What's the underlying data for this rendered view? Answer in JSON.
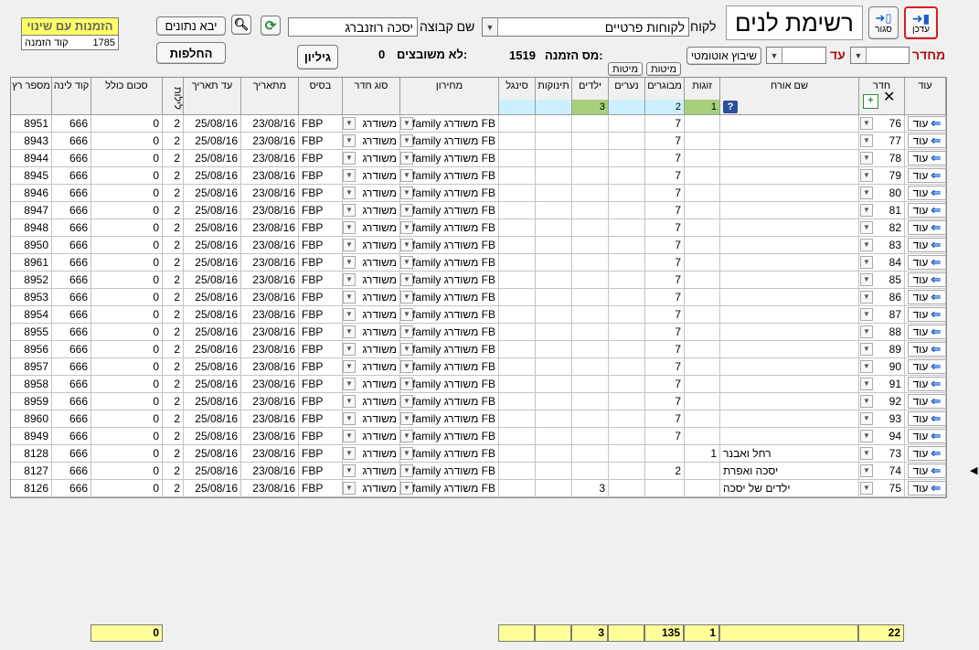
{
  "window": {
    "title": "רשימת לנים"
  },
  "toolbar": {
    "update_label": "עדכן",
    "close_label": "סגור",
    "bring_data_label": "יבא נתונים",
    "swaps_label": "החלפות",
    "sheet_label": "גיליון",
    "auto_assign_label": "שיבוץ אוטומטי",
    "sort_label_1": "מיטות",
    "sort_label_2": "מיטות"
  },
  "header": {
    "customer_label": "לקוח",
    "customer_value": "לקוחות פרטיים",
    "group_label": "שם קבוצה",
    "group_value": "יסכה רוזנברג",
    "changed_orders_label": "הזמנות עם שינוי",
    "order_code_label": "קוד הזמנה",
    "order_code_value": "1785",
    "order_number_label": "מס הזמנה:",
    "order_number_value": "1519",
    "unassigned_label": "לא משובצים:",
    "unassigned_value": "0",
    "from_room_label": "מחדר",
    "to_room_label": "עד"
  },
  "columns": {
    "action": "עוד",
    "room": "חדר",
    "guest": "שם אורח",
    "couples": "זוגות",
    "adults": "מבוגרים",
    "teens": "נערים",
    "children": "ילדים",
    "infants": "תינוקות",
    "signal": "סינגל",
    "price": "מחירון",
    "room_type": "סוג חדר",
    "base": "בסיס",
    "from_date": "מתאריך",
    "to_date": "עד תאריך",
    "nights": "לילות",
    "total": "סכום כולל",
    "line_code": "קוד לינה",
    "run_number": "מספר רץ"
  },
  "filter_row": {
    "couples": "1",
    "adults": "2",
    "children": "3"
  },
  "rows": [
    {
      "action": "עוד",
      "room": "76",
      "guest": "",
      "couples": "",
      "adults": "7",
      "teens": "",
      "children": "",
      "price": "FB משודרג family",
      "room_type": "משודרג",
      "base": "FBP",
      "from_date": "23/08/16",
      "to_date": "25/08/16",
      "nights": "2",
      "total": "0",
      "line_code": "666",
      "run": "8951"
    },
    {
      "action": "עוד",
      "room": "77",
      "guest": "",
      "couples": "",
      "adults": "7",
      "teens": "",
      "children": "",
      "price": "FB משודרג family",
      "room_type": "משודרג",
      "base": "FBP",
      "from_date": "23/08/16",
      "to_date": "25/08/16",
      "nights": "2",
      "total": "0",
      "line_code": "666",
      "run": "8943"
    },
    {
      "action": "עוד",
      "room": "78",
      "guest": "",
      "couples": "",
      "adults": "7",
      "teens": "",
      "children": "",
      "price": "FB משודרג family",
      "room_type": "משודרג",
      "base": "FBP",
      "from_date": "23/08/16",
      "to_date": "25/08/16",
      "nights": "2",
      "total": "0",
      "line_code": "666",
      "run": "8944"
    },
    {
      "action": "עוד",
      "room": "79",
      "guest": "",
      "couples": "",
      "adults": "7",
      "teens": "",
      "children": "",
      "price": "FB משודרג family",
      "room_type": "משודרג",
      "base": "FBP",
      "from_date": "23/08/16",
      "to_date": "25/08/16",
      "nights": "2",
      "total": "0",
      "line_code": "666",
      "run": "8945"
    },
    {
      "action": "עוד",
      "room": "80",
      "guest": "",
      "couples": "",
      "adults": "7",
      "teens": "",
      "children": "",
      "price": "FB משודרג family",
      "room_type": "משודרג",
      "base": "FBP",
      "from_date": "23/08/16",
      "to_date": "25/08/16",
      "nights": "2",
      "total": "0",
      "line_code": "666",
      "run": "8946"
    },
    {
      "action": "עוד",
      "room": "81",
      "guest": "",
      "couples": "",
      "adults": "7",
      "teens": "",
      "children": "",
      "price": "FB משודרג family",
      "room_type": "משודרג",
      "base": "FBP",
      "from_date": "23/08/16",
      "to_date": "25/08/16",
      "nights": "2",
      "total": "0",
      "line_code": "666",
      "run": "8947"
    },
    {
      "action": "עוד",
      "room": "82",
      "guest": "",
      "couples": "",
      "adults": "7",
      "teens": "",
      "children": "",
      "price": "FB משודרג family",
      "room_type": "משודרג",
      "base": "FBP",
      "from_date": "23/08/16",
      "to_date": "25/08/16",
      "nights": "2",
      "total": "0",
      "line_code": "666",
      "run": "8948"
    },
    {
      "action": "עוד",
      "room": "83",
      "guest": "",
      "couples": "",
      "adults": "7",
      "teens": "",
      "children": "",
      "price": "FB משודרג family",
      "room_type": "משודרג",
      "base": "FBP",
      "from_date": "23/08/16",
      "to_date": "25/08/16",
      "nights": "2",
      "total": "0",
      "line_code": "666",
      "run": "8950"
    },
    {
      "action": "עוד",
      "room": "84",
      "guest": "",
      "couples": "",
      "adults": "7",
      "teens": "",
      "children": "",
      "price": "FB משודרג family",
      "room_type": "משודרג",
      "base": "FBP",
      "from_date": "23/08/16",
      "to_date": "25/08/16",
      "nights": "2",
      "total": "0",
      "line_code": "666",
      "run": "8961"
    },
    {
      "action": "עוד",
      "room": "85",
      "guest": "",
      "couples": "",
      "adults": "7",
      "teens": "",
      "children": "",
      "price": "FB משודרג family",
      "room_type": "משודרג",
      "base": "FBP",
      "from_date": "23/08/16",
      "to_date": "25/08/16",
      "nights": "2",
      "total": "0",
      "line_code": "666",
      "run": "8952"
    },
    {
      "action": "עוד",
      "room": "86",
      "guest": "",
      "couples": "",
      "adults": "7",
      "teens": "",
      "children": "",
      "price": "FB משודרג family",
      "room_type": "משודרג",
      "base": "FBP",
      "from_date": "23/08/16",
      "to_date": "25/08/16",
      "nights": "2",
      "total": "0",
      "line_code": "666",
      "run": "8953"
    },
    {
      "action": "עוד",
      "room": "87",
      "guest": "",
      "couples": "",
      "adults": "7",
      "teens": "",
      "children": "",
      "price": "FB משודרג family",
      "room_type": "משודרג",
      "base": "FBP",
      "from_date": "23/08/16",
      "to_date": "25/08/16",
      "nights": "2",
      "total": "0",
      "line_code": "666",
      "run": "8954"
    },
    {
      "action": "עוד",
      "room": "88",
      "guest": "",
      "couples": "",
      "adults": "7",
      "teens": "",
      "children": "",
      "price": "FB משודרג family",
      "room_type": "משודרג",
      "base": "FBP",
      "from_date": "23/08/16",
      "to_date": "25/08/16",
      "nights": "2",
      "total": "0",
      "line_code": "666",
      "run": "8955"
    },
    {
      "action": "עוד",
      "room": "89",
      "guest": "",
      "couples": "",
      "adults": "7",
      "teens": "",
      "children": "",
      "price": "FB משודרג family",
      "room_type": "משודרג",
      "base": "FBP",
      "from_date": "23/08/16",
      "to_date": "25/08/16",
      "nights": "2",
      "total": "0",
      "line_code": "666",
      "run": "8956"
    },
    {
      "action": "עוד",
      "room": "90",
      "guest": "",
      "couples": "",
      "adults": "7",
      "teens": "",
      "children": "",
      "price": "FB משודרג family",
      "room_type": "משודרג",
      "base": "FBP",
      "from_date": "23/08/16",
      "to_date": "25/08/16",
      "nights": "2",
      "total": "0",
      "line_code": "666",
      "run": "8957"
    },
    {
      "action": "עוד",
      "room": "91",
      "guest": "",
      "couples": "",
      "adults": "7",
      "teens": "",
      "children": "",
      "price": "FB משודרג family",
      "room_type": "משודרג",
      "base": "FBP",
      "from_date": "23/08/16",
      "to_date": "25/08/16",
      "nights": "2",
      "total": "0",
      "line_code": "666",
      "run": "8958"
    },
    {
      "action": "עוד",
      "room": "92",
      "guest": "",
      "couples": "",
      "adults": "7",
      "teens": "",
      "children": "",
      "price": "FB משודרג family",
      "room_type": "משודרג",
      "base": "FBP",
      "from_date": "23/08/16",
      "to_date": "25/08/16",
      "nights": "2",
      "total": "0",
      "line_code": "666",
      "run": "8959"
    },
    {
      "action": "עוד",
      "room": "93",
      "guest": "",
      "couples": "",
      "adults": "7",
      "teens": "",
      "children": "",
      "price": "FB משודרג family",
      "room_type": "משודרג",
      "base": "FBP",
      "from_date": "23/08/16",
      "to_date": "25/08/16",
      "nights": "2",
      "total": "0",
      "line_code": "666",
      "run": "8960"
    },
    {
      "action": "עוד",
      "room": "94",
      "guest": "",
      "couples": "",
      "adults": "7",
      "teens": "",
      "children": "",
      "price": "FB משודרג family",
      "room_type": "משודרג",
      "base": "FBP",
      "from_date": "23/08/16",
      "to_date": "25/08/16",
      "nights": "2",
      "total": "0",
      "line_code": "666",
      "run": "8949"
    },
    {
      "action": "עוד",
      "room": "73",
      "guest": "רחל ואבנר",
      "couples": "1",
      "adults": "",
      "teens": "",
      "children": "",
      "price": "FB משודרג family",
      "room_type": "משודרג",
      "base": "FBP",
      "from_date": "23/08/16",
      "to_date": "25/08/16",
      "nights": "2",
      "total": "0",
      "line_code": "666",
      "run": "8128"
    },
    {
      "action": "עוד",
      "room": "74",
      "guest": "יסכה ואפרת",
      "couples": "",
      "adults": "2",
      "teens": "",
      "children": "",
      "price": "FB משודרג family",
      "room_type": "משודרג",
      "base": "FBP",
      "from_date": "23/08/16",
      "to_date": "25/08/16",
      "nights": "2",
      "total": "0",
      "line_code": "666",
      "run": "8127"
    },
    {
      "action": "עוד",
      "room": "75",
      "guest": "ילדים של יסכה",
      "couples": "",
      "adults": "",
      "teens": "",
      "children": "3",
      "price": "FB משודרג family",
      "room_type": "משודרג",
      "base": "FBP",
      "from_date": "23/08/16",
      "to_date": "25/08/16",
      "nights": "2",
      "total": "0",
      "line_code": "666",
      "run": "8126"
    }
  ],
  "totals": {
    "rooms": "22",
    "couples": "1",
    "adults": "135",
    "children": "3",
    "total_sum": "0"
  },
  "colors": {
    "accent_red": "#d81e1e",
    "highlight_yellow": "#ffff99",
    "filter_blue": "#ccf0ff",
    "filter_green": "#a6cf7a",
    "arrow_blue": "#1d5fc9"
  }
}
